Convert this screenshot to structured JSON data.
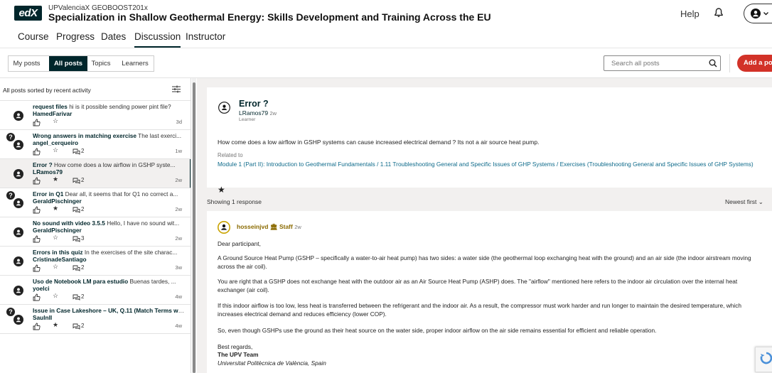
{
  "header": {
    "logo_text": "edX",
    "org": "UPValenciaX GEOBOOST201x",
    "course_title": "Specialization in Shallow Geothermal Energy: Skills Development and Training Across the EU",
    "help_label": "Help"
  },
  "course_tabs": [
    "Course",
    "Progress",
    "Dates",
    "Discussion",
    "Instructor"
  ],
  "post_tabs": [
    "My posts",
    "All posts",
    "Topics",
    "Learners"
  ],
  "search": {
    "placeholder": "Search all posts"
  },
  "add_post_label": "Add a post",
  "sort_label": "All posts sorted by recent activity",
  "posts": [
    {
      "title": "request files",
      "preview": " hi  is it possible sending power pint file?",
      "author": "HamedFarivar",
      "question": false,
      "star": "☆",
      "comments": "",
      "time": "3d"
    },
    {
      "title": "Wrong answers in matching exercise",
      "preview": " The last exerci...",
      "author": "angel_cerqueiro",
      "question": true,
      "star": "☆",
      "comments": "2",
      "time": "1w"
    },
    {
      "title": "Error ?",
      "preview": " How come does a low airflow in GSHP syste...",
      "author": "LRamos79",
      "question": false,
      "star": "★",
      "comments": "2",
      "time": "2w"
    },
    {
      "title": "Error in Q1",
      "preview": " Dear all, it seems that for Q1 no correct a...",
      "author": "GeraldPischinger",
      "question": true,
      "star": "★",
      "comments": "2",
      "time": "2w"
    },
    {
      "title": "No sound with video 3.5.5",
      "preview": " Hello, I have no sound wit...",
      "author": "GeraldPischinger",
      "question": false,
      "star": "☆",
      "comments": "3",
      "time": "2w"
    },
    {
      "title": "Errors in this quiz",
      "preview": " In the exercises of the site charac...",
      "author": "CristinadeSantiago",
      "question": false,
      "star": "☆",
      "comments": "2",
      "time": "3w"
    },
    {
      "title": "Uso de Notebook LM para estudio",
      "preview": " Buenas tardes, ...",
      "author": "yoelci",
      "question": false,
      "star": "☆",
      "comments": "2",
      "time": "4w"
    },
    {
      "title": "Issue in Case Lakeshore – UK, Q.11 (Match Terms wit...",
      "preview": "",
      "author": "SaulnII",
      "question": true,
      "star": "★",
      "comments": "2",
      "time": "4w"
    }
  ],
  "thread": {
    "title": "Error ?",
    "author": "LRamos79",
    "time": "2w",
    "role": "Learner",
    "body": "How come does a low airflow in GSHP systems can cause increased electrical demand ? Its not a air source heat pump.",
    "related_label": "Related to",
    "related_link": "Module 1 (Part II): Introduction to Geothermal Fundamentals / 1.11 Troubleshooting General and Specific Issues of GHP Systems / Exercises (Troubleshooting General and Specific Issues of GHP Systems)",
    "star": "★"
  },
  "responses_header": {
    "count": "Showing 1 response",
    "sort": "Newest first"
  },
  "response": {
    "author": "hosseinjvd",
    "badge": "Staff",
    "time": "2w",
    "greeting": "Dear participant,",
    "p1": "A Ground Source Heat Pump (GSHP – specifically a water-to-air heat pump) has two sides: a water side (the geothermal loop exchanging heat with the ground) and an air side (the indoor airstream moving across the air coil).",
    "p2": "You are right that a GSHP does not exchange heat with the outdoor air as an Air Source Heat Pump (ASHP) does. The \"airflow\" mentioned here refers to the indoor air circulation over the internal heat exchanger (air coil).",
    "p3": "If this indoor airflow is too low, less heat is transferred between the refrigerant and the indoor air. As a result, the compressor must work harder and run longer to maintain the desired temperature, which increases electrical demand and reduces efficiency (lower COP).",
    "p4": "So, even though GSHPs use the ground as their heat source on the water side, proper indoor airflow on the air side remains essential for efficient and reliable operation.",
    "signoff": "Best regards,",
    "team": "The UPV Team",
    "org": "Universitat Politècnica de València, Spain"
  },
  "colors": {
    "brand_dark": "#00262b",
    "accent": "#d23228",
    "link": "#0d6a8a",
    "staff": "#8a6a00"
  }
}
